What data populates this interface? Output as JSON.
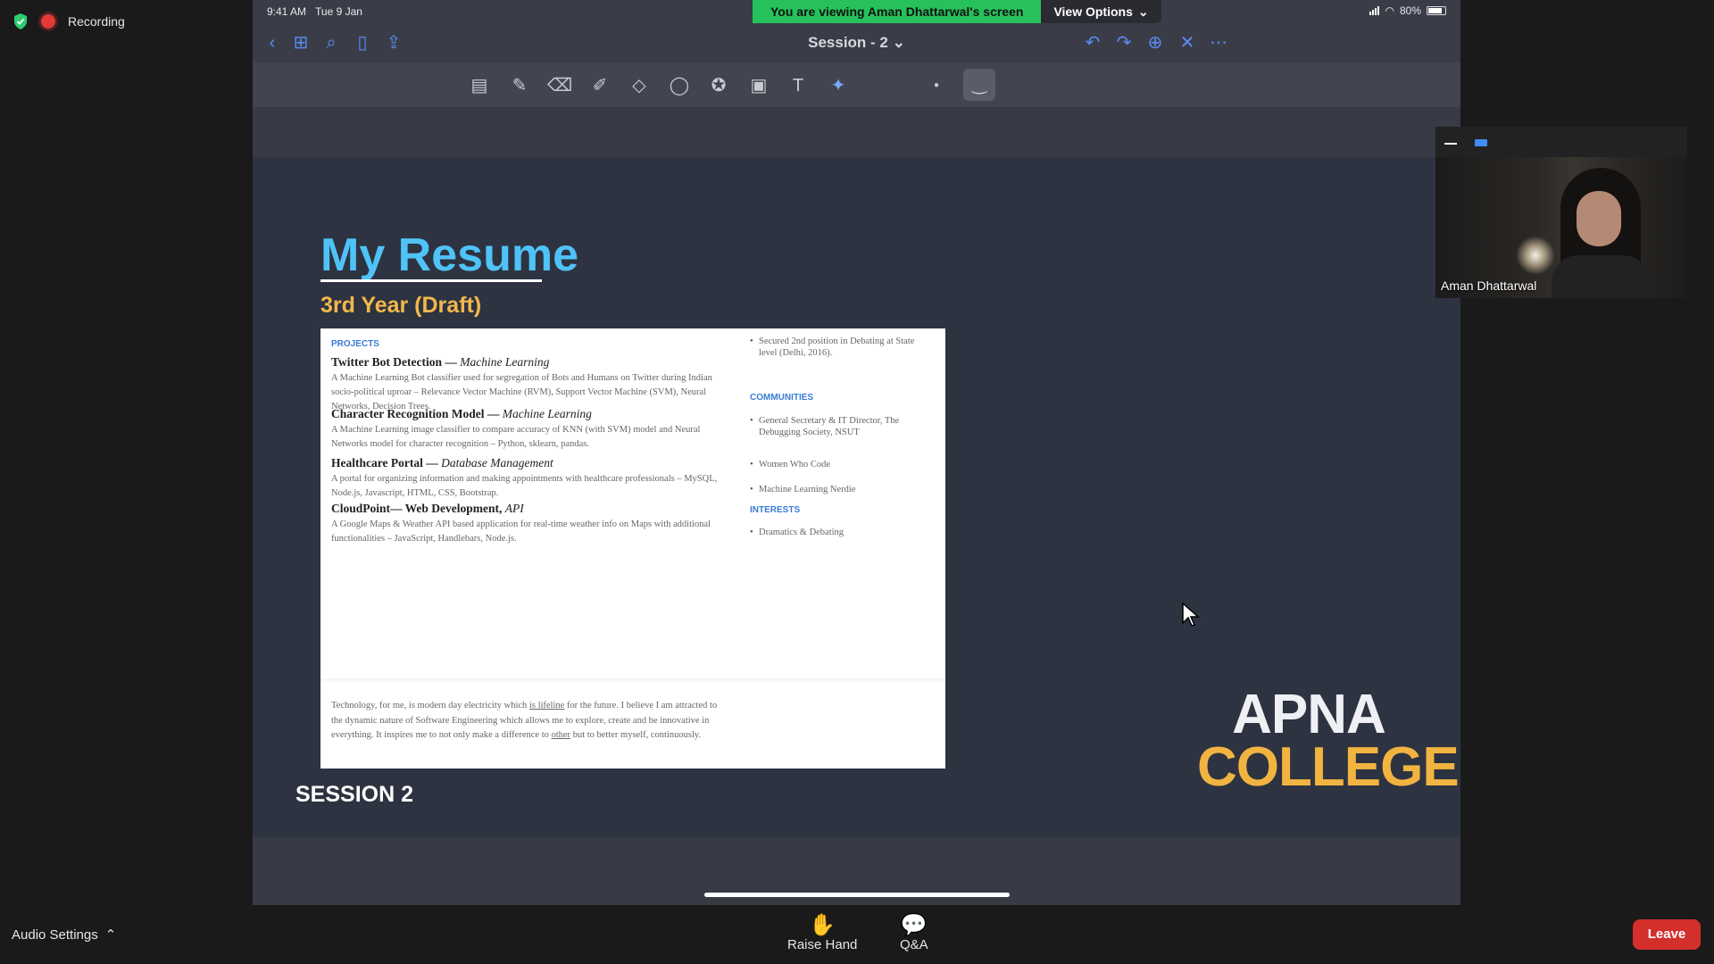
{
  "recording": {
    "label": "Recording"
  },
  "banner": {
    "viewing": "You are viewing Aman Dhattarwal's screen",
    "view_options": "View Options"
  },
  "ipad": {
    "time": "9:41 AM",
    "date": "Tue 9 Jan",
    "battery": "80%",
    "doc_title": "Session - 2"
  },
  "slide": {
    "title": "My Resume",
    "subtitle": "3rd Year (Draft)",
    "session": "SESSION 2",
    "logo_line1": "APNA",
    "logo_line2": "COLLEGE"
  },
  "resume": {
    "projects_header": "PROJECTS",
    "projects": [
      {
        "name": "Twitter Bot Detection —",
        "area": "Machine Learning",
        "desc": "A Machine Learning Bot classifier used for segregation of Bots and Humans on Twitter during Indian socio-political uproar – Relevance Vector Machine (RVM), Support Vector Machine (SVM), Neural Networks, Decision Trees."
      },
      {
        "name": "Character Recognition Model —",
        "area": "Machine Learning",
        "desc": "A Machine Learning image classifier to compare accuracy of KNN (with SVM) model and Neural Networks model for character recognition – Python, sklearn, pandas."
      },
      {
        "name": "Healthcare Portal —",
        "area": "Database Management",
        "desc": "A portal for organizing information and making appointments with healthcare professionals – MySQL, Node.js, Javascript, HTML, CSS, Bootstrap."
      },
      {
        "name": "CloudPoint— Web Development,",
        "area": "API",
        "desc": "A Google Maps & Weather API based application for real-time weather info on Maps with additional functionalities – JavaScript, Handlebars, Node.js."
      }
    ],
    "achievement": "Secured 2nd position in Debating at State level (Delhi, 2016).",
    "communities_header": "COMMUNITIES",
    "communities": [
      "General Secretary & IT Director, The Debugging Society, NSUT",
      "Women Who Code",
      "Machine Learning Nerdie"
    ],
    "interests_header": "INTERESTS",
    "interests": [
      "Dramatics & Debating"
    ],
    "summary_a": "Technology, for me, is modern day electricity which ",
    "summary_link1": "is lifeline",
    "summary_b": " for the future. I believe I am attracted to the dynamic nature of Software Engineering which allows me to explore, create and be innovative in everything. It inspires me to not only make a difference to ",
    "summary_link2": "other",
    "summary_c": " but to better myself, continuously."
  },
  "participant": {
    "name": "Aman Dhattarwal"
  },
  "bottom": {
    "audio_settings": "Audio Settings",
    "raise_hand": "Raise Hand",
    "qa": "Q&A",
    "leave": "Leave"
  },
  "colors": {
    "accent_blue": "#5b8bef",
    "banner_green": "#26c15b",
    "leave_red": "#d3302c",
    "title_cyan": "#4fc3f7",
    "subtitle_gold": "#f2b84b"
  },
  "icons": [
    "back-icon",
    "grid-icon",
    "search-icon",
    "bookmark-icon",
    "share-icon",
    "undo-icon",
    "redo-icon",
    "add-page-icon",
    "close-icon",
    "more-icon",
    "pen-icon",
    "eraser-icon",
    "highlighter-icon",
    "shapes-icon",
    "lasso-icon",
    "sticker-icon",
    "image-icon",
    "text-icon",
    "laser-icon"
  ]
}
